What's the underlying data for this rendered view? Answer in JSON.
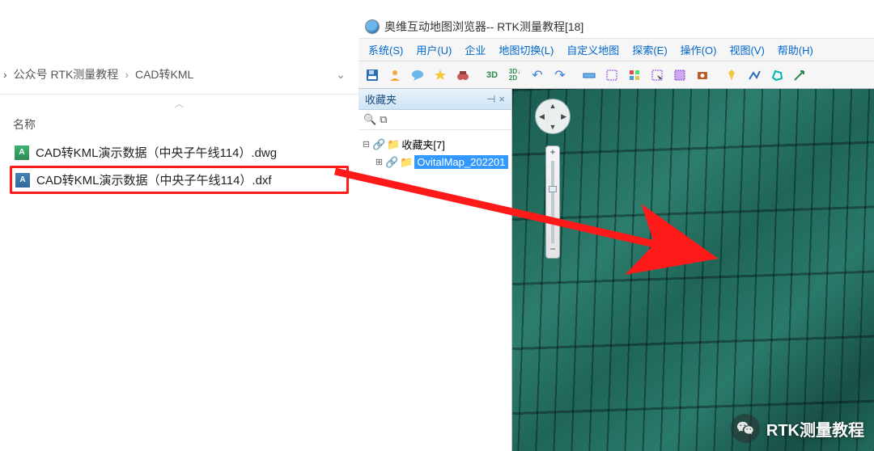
{
  "explorer": {
    "breadcrumb": [
      "公众号 RTK测量教程",
      "CAD转KML"
    ],
    "column_header": "名称",
    "collapse_caret": "︿",
    "dropdown_caret": "⌄",
    "files": [
      {
        "name": "CAD转KML演示数据（中央子午线114）.dwg",
        "icon": "dwg",
        "highlight": false
      },
      {
        "name": "CAD转KML演示数据（中央子午线114）.dxf",
        "icon": "dxf",
        "highlight": true
      }
    ]
  },
  "browser": {
    "title": "奥维互动地图浏览器-- RTK测量教程[18]",
    "menus": [
      "系统(S)",
      "用户(U)",
      "企业",
      "地图切换(L)",
      "自定义地图",
      "探索(E)",
      "操作(O)",
      "视图(V)",
      "帮助(H)"
    ],
    "toolbar_icons": [
      "save-icon",
      "user-icon",
      "chat-icon",
      "star-icon",
      "binoculars-icon",
      "3d-icon",
      "3d2d-icon",
      "undo-icon",
      "redo-icon",
      "ruler-icon",
      "grid-icon",
      "color-grid-icon",
      "select-icon",
      "select-area-icon",
      "screenshot-icon",
      "pin-icon",
      "path-icon",
      "polygon-icon",
      "arrow-icon"
    ],
    "fav_panel": {
      "header": "收藏夹",
      "pin": "⊣",
      "close": "×",
      "search_icon": "🔍",
      "layers_icon": "⧉",
      "root_label": "收藏夹[7]",
      "child_label": "OvitalMap_202201"
    },
    "zoom": {
      "plus": "+",
      "minus": "−"
    }
  },
  "watermark": {
    "text": "RTK测量教程"
  }
}
